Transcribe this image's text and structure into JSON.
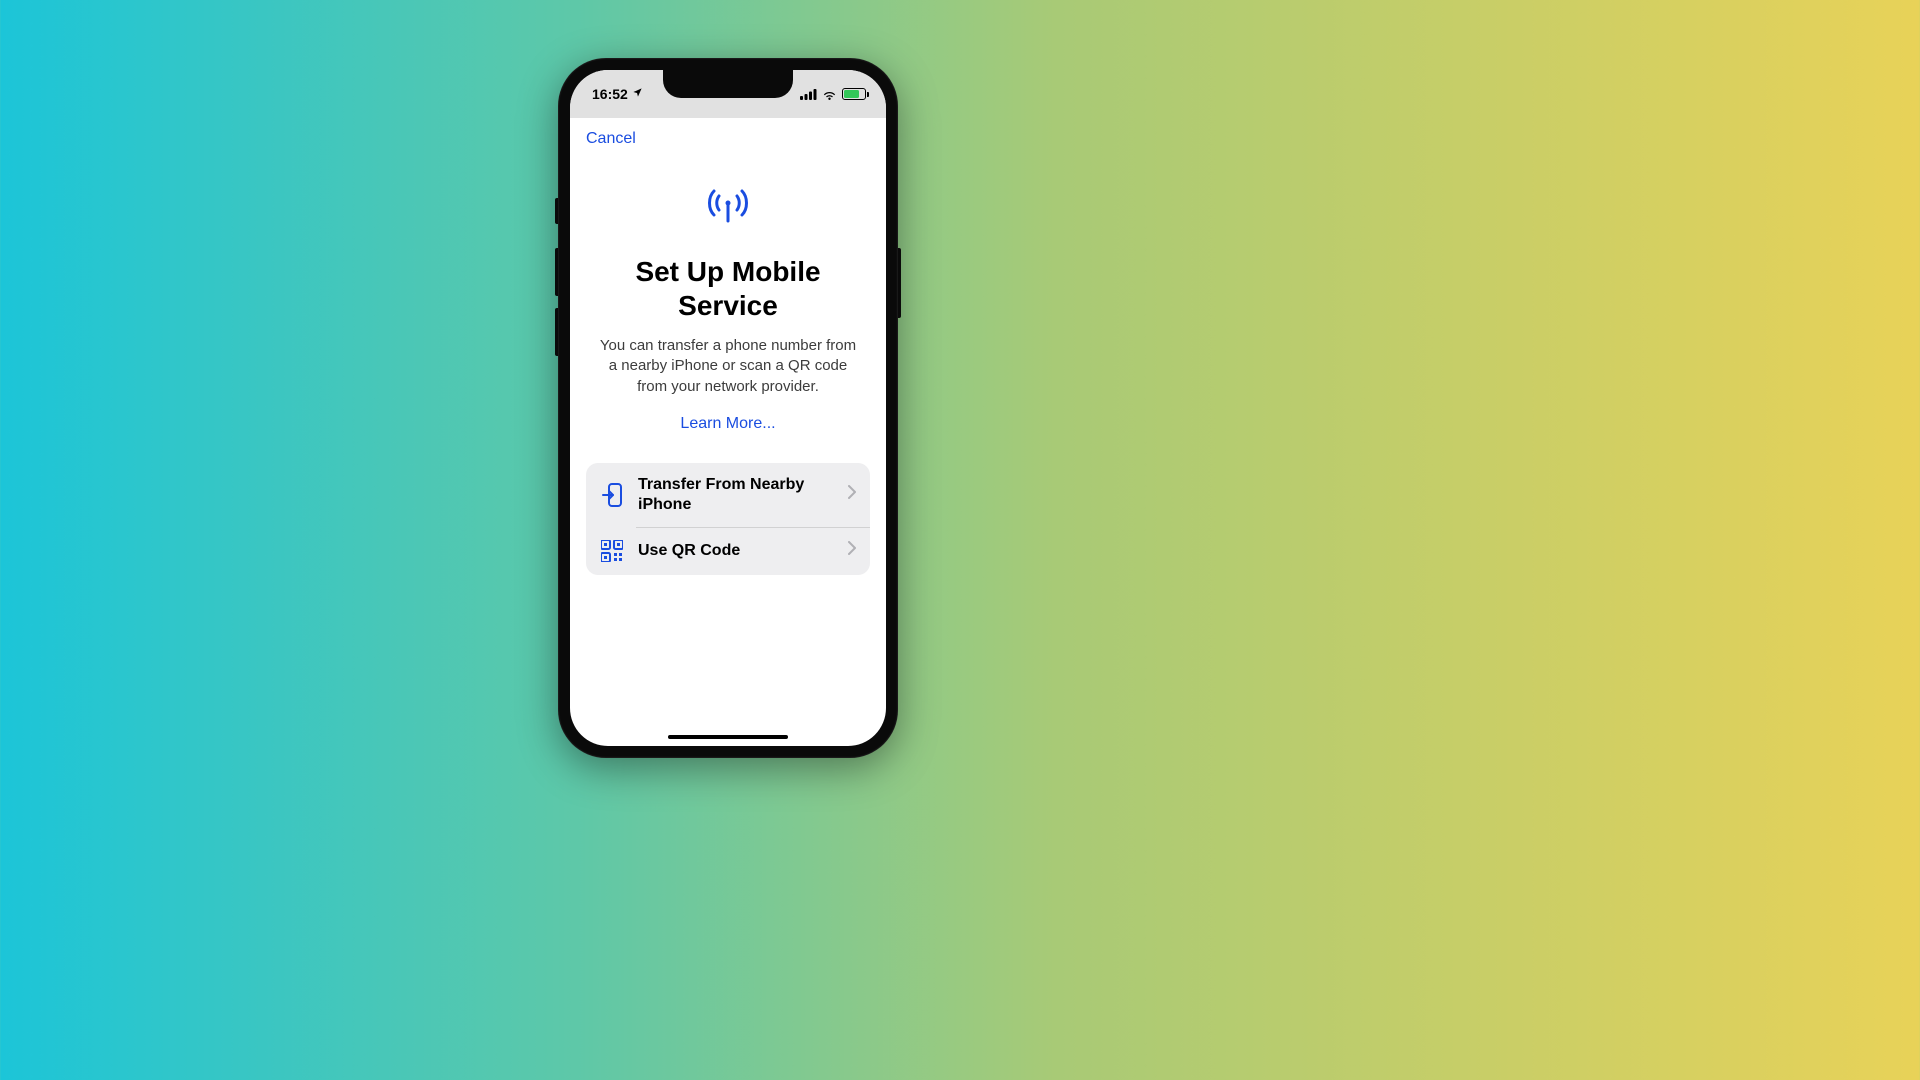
{
  "statusBar": {
    "time": "16:52"
  },
  "nav": {
    "cancel": "Cancel"
  },
  "page": {
    "title": "Set Up Mobile Service",
    "description": "You can transfer a phone number from a nearby iPhone or scan a QR code from your network provider.",
    "learnMore": "Learn More..."
  },
  "options": [
    {
      "label": "Transfer From Nearby iPhone",
      "icon": "transfer-in-icon"
    },
    {
      "label": "Use QR Code",
      "icon": "qr-code-icon"
    }
  ]
}
